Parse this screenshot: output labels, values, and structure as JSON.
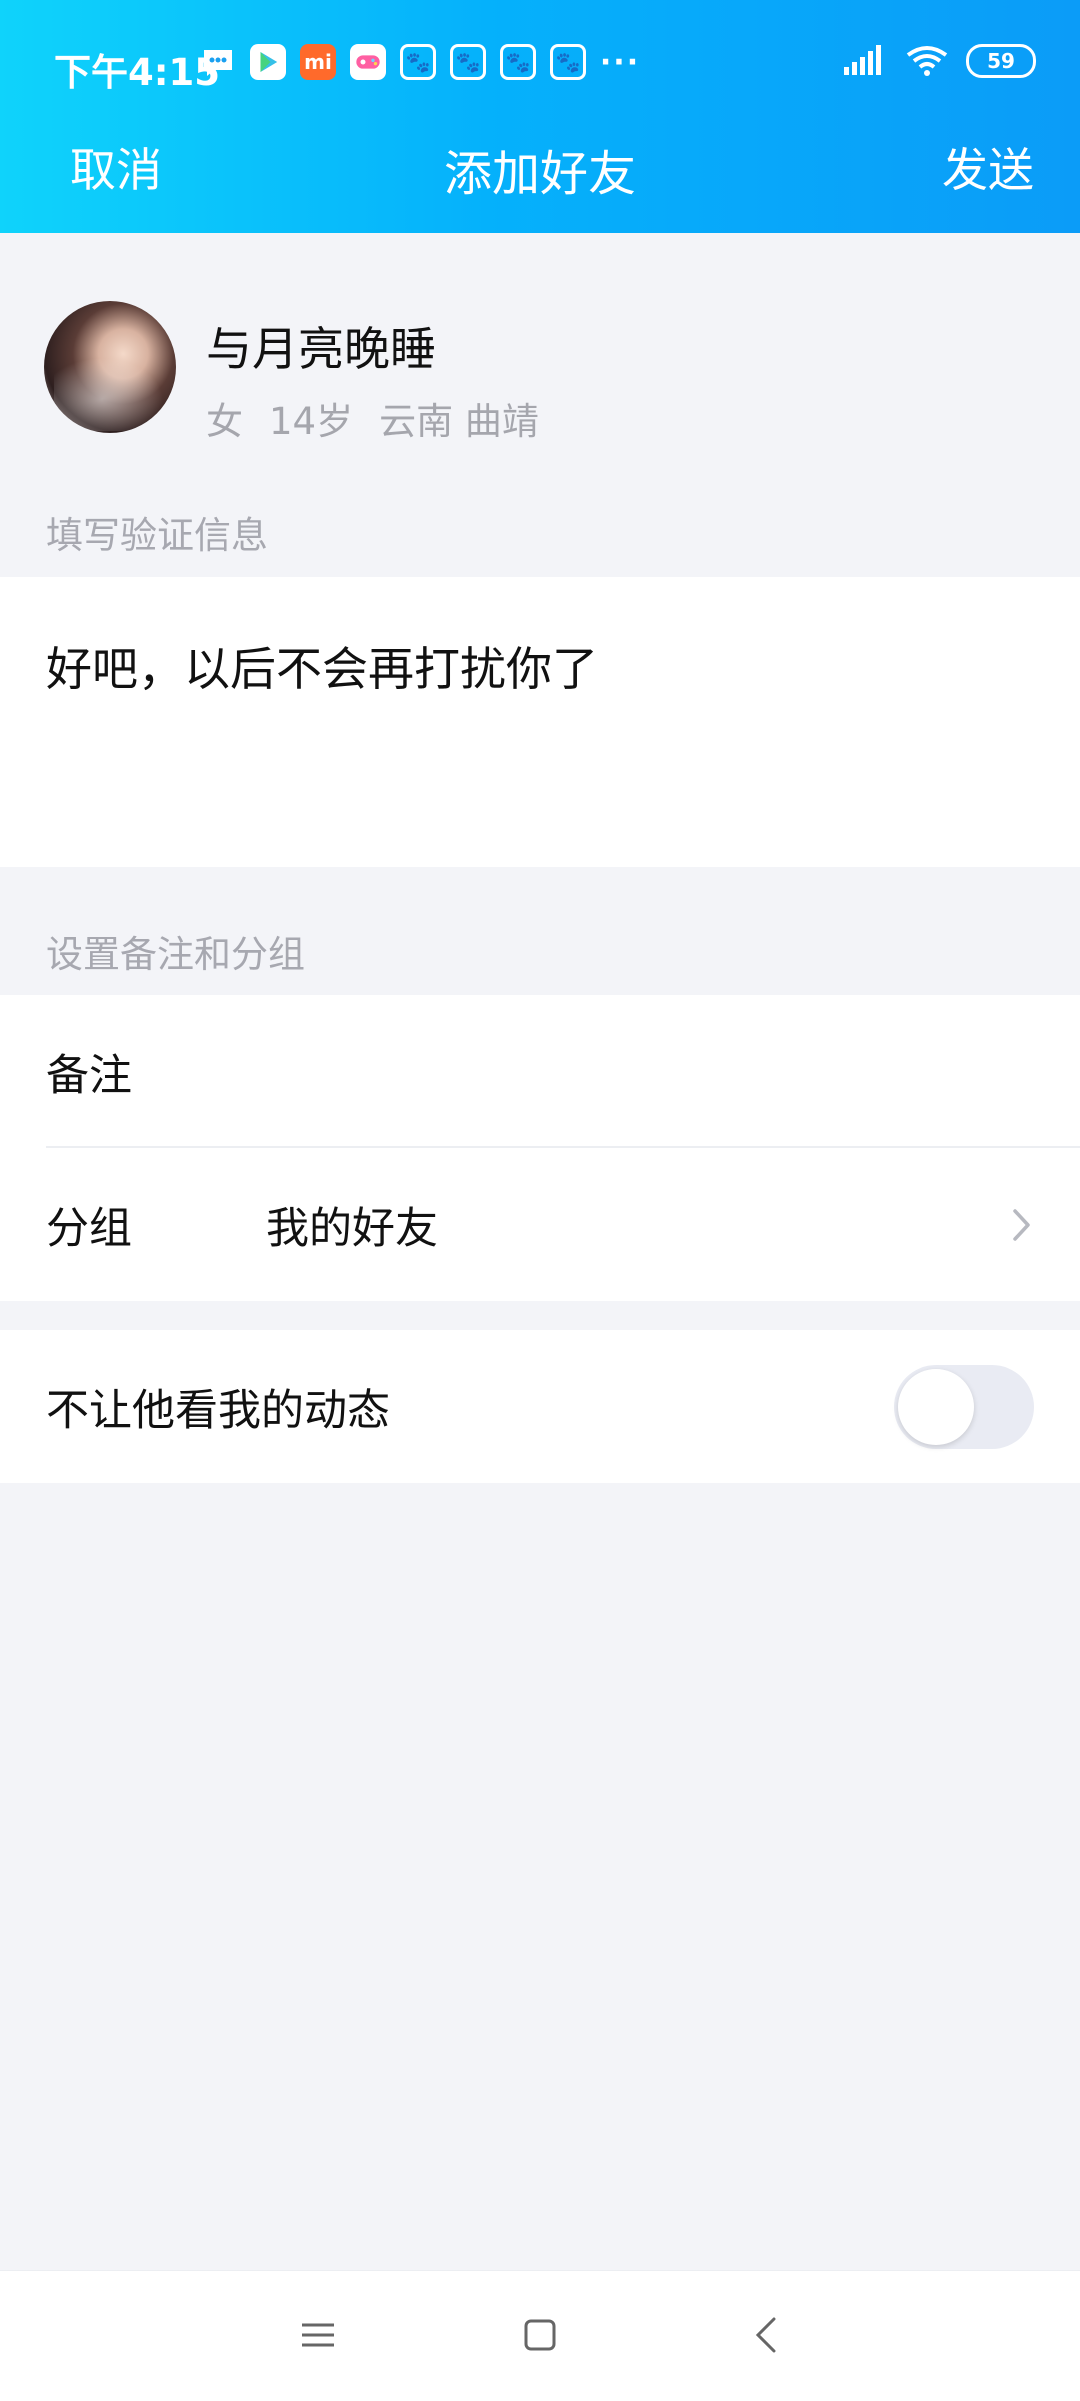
{
  "status_bar": {
    "time": "下午4:15",
    "notification_icons": [
      "message-icon",
      "play-store-icon",
      "mi-icon",
      "game-icon",
      "baidu-icon",
      "baidu-icon",
      "baidu-icon",
      "baidu-icon",
      "more-dots-icon"
    ],
    "battery": "59"
  },
  "header": {
    "cancel_label": "取消",
    "title": "添加好友",
    "send_label": "发送"
  },
  "profile": {
    "nickname": "与月亮晚睡",
    "gender": "女",
    "age": "14岁",
    "location": "云南 曲靖"
  },
  "verify": {
    "section_label": "填写验证信息",
    "message": "好吧，以后不会再打扰你了"
  },
  "settings": {
    "section_label": "设置备注和分组",
    "remark_label": "备注",
    "remark_value": "",
    "group_label": "分组",
    "group_value": "我的好友"
  },
  "privacy": {
    "hide_moments_label": "不让他看我的动态",
    "hide_moments_enabled": false
  },
  "colors": {
    "header_gradient_start": "#0fd3fb",
    "header_gradient_end": "#0b9cf8",
    "background": "#f3f4f8",
    "secondary_text": "#a5a6ad"
  }
}
